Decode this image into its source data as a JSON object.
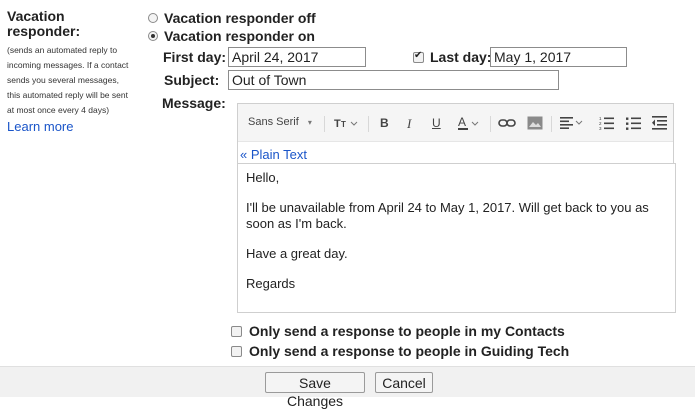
{
  "section": {
    "title_line1": "Vacation",
    "title_line2": "responder:",
    "note_lines": [
      "(sends an automated reply to",
      "incoming messages. If a contact",
      "sends you several messages,",
      "this automated reply will be sent",
      "at most once every 4 days)"
    ],
    "learn_more": "Learn more"
  },
  "responder": {
    "off_label": "Vacation responder off",
    "on_label": "Vacation responder on",
    "selected": "on"
  },
  "fields": {
    "first_day_label": "First day:",
    "first_day_value": "April 24, 2017",
    "last_day_label": "Last day:",
    "last_day_value": "May 1, 2017",
    "last_day_checked": true,
    "subject_label": "Subject:",
    "subject_value": "Out of Town",
    "message_label": "Message:"
  },
  "toolbar": {
    "font_name": "Sans Serif",
    "icons": [
      "font-size-icon",
      "bold-icon",
      "italic-icon",
      "underline-icon",
      "text-color-icon",
      "link-icon",
      "image-icon",
      "align-icon",
      "numbered-list-icon",
      "bulleted-list-icon",
      "indent-less-icon"
    ]
  },
  "plain_text_link": "« Plain Text",
  "message_body": {
    "greeting": "Hello,",
    "line1": "I'll be unavailable from April 24 to May 1, 2017. Will get back to you as",
    "line2": "soon as I'm back.",
    "line3": "Have a great day.",
    "sign": "Regards"
  },
  "options": {
    "contacts_only": "Only send a response to people in my Contacts",
    "domain_only": "Only send a response to people in Guiding Tech"
  },
  "buttons": {
    "save": "Save Changes",
    "cancel": "Cancel"
  }
}
